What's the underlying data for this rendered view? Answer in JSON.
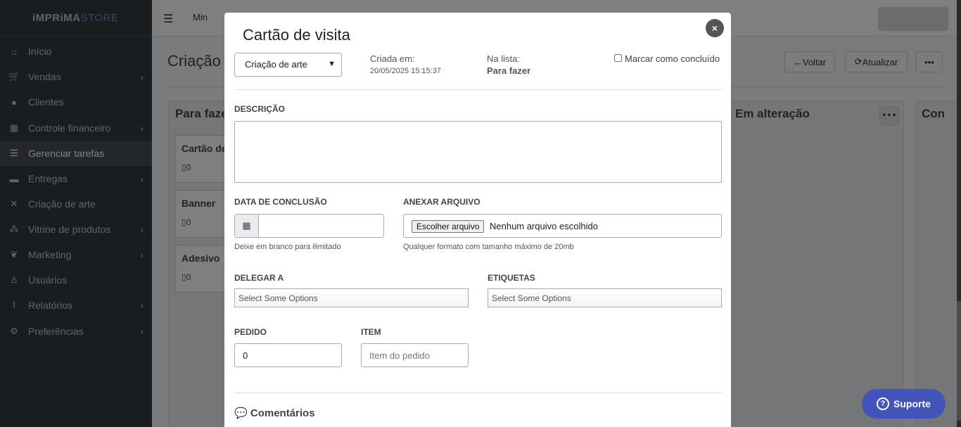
{
  "brand": {
    "main": "iMPRiMA",
    "suffix": "STORE"
  },
  "sidebar": {
    "items": [
      {
        "label": "Início",
        "icon": "home-icon",
        "glyph": "⌂",
        "chevron": false,
        "active": false
      },
      {
        "label": "Vendas",
        "icon": "cart-icon",
        "glyph": "🛒",
        "chevron": true,
        "active": false
      },
      {
        "label": "Clientes",
        "icon": "user-circle-icon",
        "glyph": "●",
        "chevron": false,
        "active": false
      },
      {
        "label": "Controle financeiro",
        "icon": "bank-icon",
        "glyph": "▦",
        "chevron": true,
        "active": false
      },
      {
        "label": "Gerenciar tarefas",
        "icon": "tasks-icon",
        "glyph": "☰",
        "chevron": false,
        "active": true
      },
      {
        "label": "Entregas",
        "icon": "truck-icon",
        "glyph": "▬",
        "chevron": true,
        "active": false
      },
      {
        "label": "Criação de arte",
        "icon": "tools-icon",
        "glyph": "✕",
        "chevron": false,
        "active": false
      },
      {
        "label": "Vitrine de produtos",
        "icon": "sitemap-icon",
        "glyph": "⁂",
        "chevron": true,
        "active": false
      },
      {
        "label": "Marketing",
        "icon": "leaf-icon",
        "glyph": "❦",
        "chevron": true,
        "active": false
      },
      {
        "label": "Usuários",
        "icon": "person-icon",
        "glyph": "♙",
        "chevron": false,
        "active": false
      },
      {
        "label": "Relatórios",
        "icon": "chart-line-icon",
        "glyph": "⌇",
        "chevron": true,
        "active": false
      },
      {
        "label": "Preferências",
        "icon": "cogs-icon",
        "glyph": "⚙",
        "chevron": true,
        "active": false
      }
    ]
  },
  "navbar": {
    "link_label": "Min"
  },
  "page": {
    "title": "Criação",
    "buttons": {
      "back": "Voltar",
      "refresh": "Atualizar",
      "more": "•••"
    },
    "columns": {
      "col1": "Para faze",
      "col2": "Em alteração",
      "col3": "Con"
    },
    "cards": [
      {
        "title": "Cartão de",
        "count": "0"
      },
      {
        "title": "Banner",
        "count": "0"
      },
      {
        "title": "Adesivo",
        "count": "0"
      }
    ]
  },
  "modal": {
    "title": "Cartão de visita",
    "close": "×",
    "list_select": {
      "value": "Criação de arte"
    },
    "created_label": "Criada em:",
    "created_value": "20/05/2025 15:15:37",
    "list_label": "Na lista:",
    "list_value": "Para fazer",
    "complete_label": "Marcar como concluído",
    "description_label": "DESCRIÇÃO",
    "due_date_label": "DATA DE CONCLUSÃO",
    "due_date_hint": "Deixe em branco para ilimitado",
    "attach_label": "ANEXAR ARQUIVO",
    "attach_button": "Escolher arquivo",
    "attach_status": "Nenhum arquivo escolhido",
    "attach_hint": "Qualquer formato com tamanho máximo de 20mb",
    "delegate_label": "DELEGAR A",
    "delegate_placeholder": "Select Some Options",
    "tags_label": "ETIQUETAS",
    "tags_placeholder": "Select Some Options",
    "order_label": "PEDIDO",
    "order_value": "0",
    "item_label": "ITEM",
    "item_placeholder": "Item do pedido",
    "comments_label": "Comentários"
  },
  "support": {
    "label": "Suporte"
  },
  "colors": {
    "sidebar": "#343a40",
    "accent": "#4354b8"
  }
}
